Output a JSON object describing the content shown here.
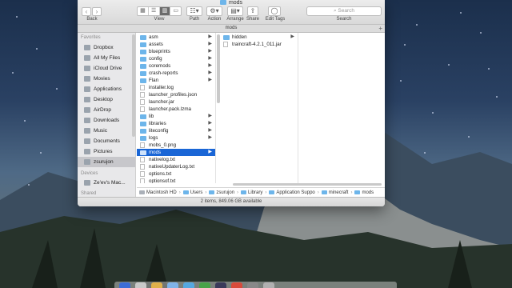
{
  "window": {
    "title": "mods",
    "path_header": "mods",
    "status": "2 items, 849.06 GB available"
  },
  "toolbar": {
    "back_label": "Back",
    "view_label": "View",
    "path_label": "Path",
    "action_label": "Action",
    "arrange_label": "Arrange",
    "share_label": "Share",
    "edit_tags_label": "Edit Tags",
    "search_label": "Search",
    "search_placeholder": "Search"
  },
  "sidebar": {
    "favorites_heading": "Favorites",
    "favorites": [
      {
        "label": "Dropbox",
        "icon": "dropbox-icon"
      },
      {
        "label": "All My Files",
        "icon": "all-files-icon"
      },
      {
        "label": "iCloud Drive",
        "icon": "cloud-icon"
      },
      {
        "label": "Movies",
        "icon": "movies-icon"
      },
      {
        "label": "Applications",
        "icon": "applications-icon"
      },
      {
        "label": "Desktop",
        "icon": "desktop-icon"
      },
      {
        "label": "AirDrop",
        "icon": "airdrop-icon"
      },
      {
        "label": "Downloads",
        "icon": "downloads-icon"
      },
      {
        "label": "Music",
        "icon": "music-icon"
      },
      {
        "label": "Documents",
        "icon": "documents-icon"
      },
      {
        "label": "Pictures",
        "icon": "pictures-icon"
      },
      {
        "label": "zsurujon",
        "icon": "home-icon"
      }
    ],
    "devices_heading": "Devices",
    "devices": [
      {
        "label": "Ze'ev's Mac...",
        "icon": "laptop-icon"
      }
    ],
    "shared_heading": "Shared"
  },
  "column1": [
    {
      "name": "asm",
      "folder": true
    },
    {
      "name": "assets",
      "folder": true
    },
    {
      "name": "blueprints",
      "folder": true
    },
    {
      "name": "config",
      "folder": true
    },
    {
      "name": "coremods",
      "folder": true
    },
    {
      "name": "crash-reports",
      "folder": true
    },
    {
      "name": "Flan",
      "folder": true
    },
    {
      "name": "installer.log",
      "folder": false
    },
    {
      "name": "launcher_profiles.json",
      "folder": false
    },
    {
      "name": "launcher.jar",
      "folder": false
    },
    {
      "name": "launcher.pack.lzma",
      "folder": false
    },
    {
      "name": "lib",
      "folder": true
    },
    {
      "name": "libraries",
      "folder": true
    },
    {
      "name": "liteconfig",
      "folder": true
    },
    {
      "name": "logs",
      "folder": true
    },
    {
      "name": "mobs_0.png",
      "folder": false
    },
    {
      "name": "mods",
      "folder": true,
      "selected": true
    },
    {
      "name": "nativelog.txt",
      "folder": false
    },
    {
      "name": "nativeUpdaterLog.txt",
      "folder": false
    },
    {
      "name": "options.txt",
      "folder": false
    },
    {
      "name": "optionsof.txt",
      "folder": false
    }
  ],
  "column2": [
    {
      "name": "hidden",
      "folder": true
    },
    {
      "name": "traincraft-4.2.1_011.jar",
      "folder": false
    }
  ],
  "pathbar": [
    "Macintosh HD",
    "Users",
    "zsurujon",
    "Library",
    "Application Suppo",
    "minecraft",
    "mods"
  ],
  "colors": {
    "selection": "#1a66d6",
    "folder": "#6db5ea"
  }
}
